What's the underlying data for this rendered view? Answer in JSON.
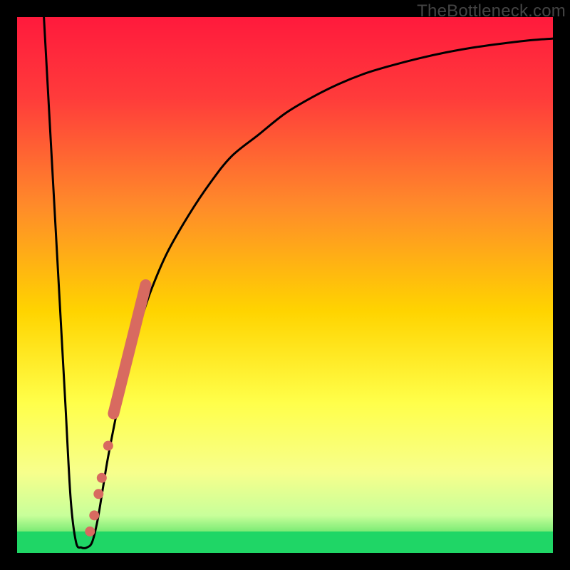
{
  "watermark": "TheBottleneck.com",
  "chart_data": {
    "type": "line",
    "title": "",
    "xlabel": "",
    "ylabel": "",
    "xlim": [
      0,
      100
    ],
    "ylim": [
      0,
      100
    ],
    "series": [
      {
        "name": "bottleneck-curve",
        "x": [
          5,
          6,
          7,
          8,
          9,
          10,
          11,
          12,
          13,
          14,
          15,
          16,
          17,
          19,
          21,
          23,
          25,
          28,
          32,
          36,
          40,
          45,
          50,
          55,
          60,
          65,
          70,
          75,
          80,
          85,
          90,
          95,
          100
        ],
        "y": [
          100,
          82,
          64,
          46,
          28,
          10,
          2,
          1,
          1,
          2,
          6,
          12,
          18,
          28,
          36,
          43,
          49,
          56,
          63,
          69,
          74,
          78,
          82,
          85,
          87.5,
          89.5,
          91,
          92.3,
          93.4,
          94.3,
          95,
          95.6,
          96
        ]
      }
    ],
    "markers": [
      {
        "name": "marker-segment-dense",
        "x": [
          18,
          18.5,
          19,
          19.5,
          20,
          20.5,
          21,
          21.5,
          22,
          22.5,
          23,
          23.5,
          24
        ],
        "y": [
          26,
          28,
          30,
          32,
          34,
          36,
          38,
          40,
          42,
          44,
          46,
          48,
          50
        ]
      },
      {
        "name": "marker-single-1",
        "x": [
          17
        ],
        "y": [
          20
        ]
      },
      {
        "name": "marker-single-2",
        "x": [
          15.8
        ],
        "y": [
          14
        ]
      },
      {
        "name": "marker-single-3",
        "x": [
          15.2
        ],
        "y": [
          11
        ]
      },
      {
        "name": "marker-single-4",
        "x": [
          14.4
        ],
        "y": [
          7
        ]
      },
      {
        "name": "marker-single-5",
        "x": [
          13.6
        ],
        "y": [
          4
        ]
      }
    ],
    "green_band": {
      "y0": 0,
      "y1": 4
    },
    "gradient_stops": [
      {
        "offset": 0.0,
        "color": "#ff1a3c"
      },
      {
        "offset": 0.15,
        "color": "#ff3b3b"
      },
      {
        "offset": 0.35,
        "color": "#ff8a2a"
      },
      {
        "offset": 0.55,
        "color": "#ffd400"
      },
      {
        "offset": 0.72,
        "color": "#ffff4a"
      },
      {
        "offset": 0.85,
        "color": "#f7ff8c"
      },
      {
        "offset": 0.93,
        "color": "#c8ff9a"
      },
      {
        "offset": 0.965,
        "color": "#6fe86f"
      },
      {
        "offset": 1.0,
        "color": "#18d060"
      }
    ]
  }
}
